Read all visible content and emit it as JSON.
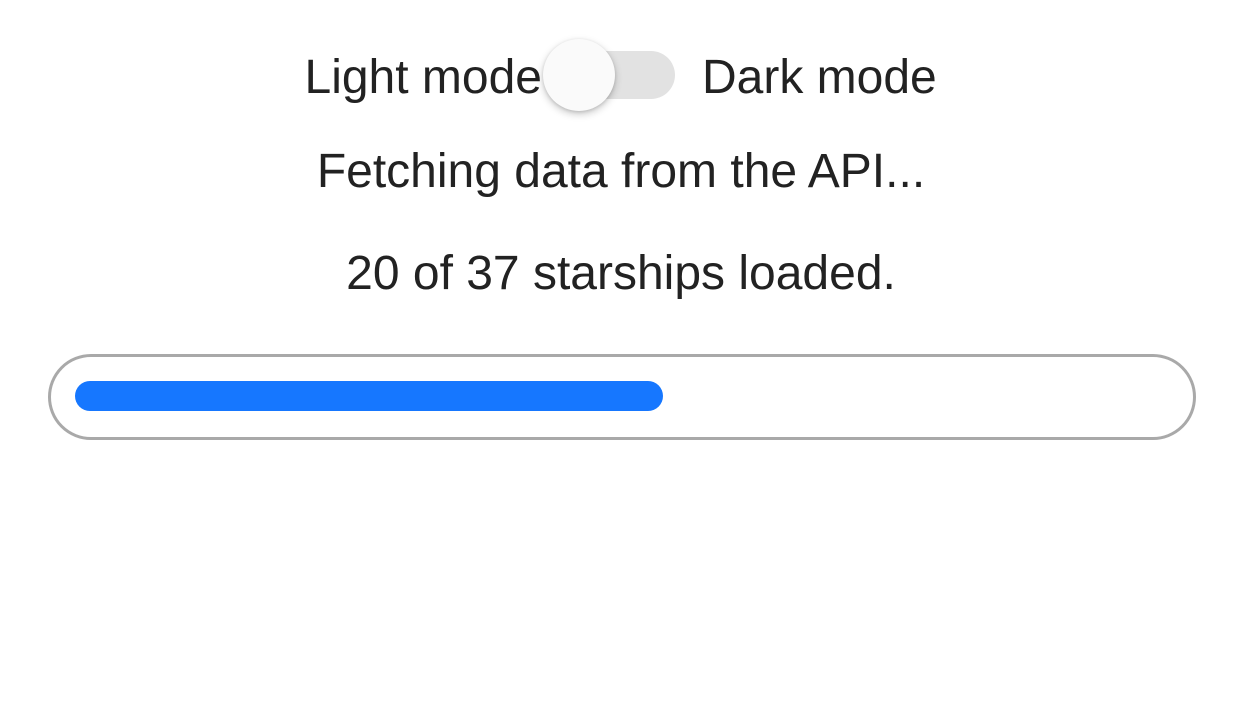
{
  "theme_toggle": {
    "light_label": "Light mode",
    "dark_label": "Dark mode",
    "state": "light"
  },
  "status": {
    "fetching_text": "Fetching data from the API...",
    "loaded_text": "20 of 37 starships loaded.",
    "loaded_count": 20,
    "total_count": 37
  },
  "progress": {
    "value": 20,
    "max": 37,
    "fill_color": "#1677ff",
    "border_color": "#a9a9a9"
  },
  "colors": {
    "text": "#222222",
    "toggle_track": "#e2e2e2",
    "toggle_thumb": "#fafafa",
    "background": "#ffffff"
  }
}
